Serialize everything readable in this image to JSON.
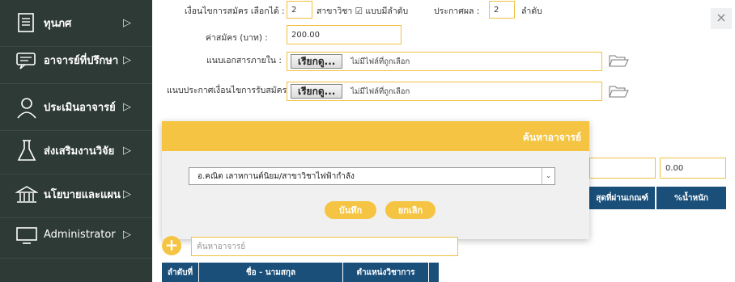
{
  "sidebar": {
    "items": [
      {
        "label": "ทุนภศ",
        "icon": "document-icon"
      },
      {
        "label": "อาจารย์ที่ปรึกษา",
        "icon": "chat-icon"
      },
      {
        "label": "ประเมินอาจารย์",
        "icon": "teacher-icon"
      },
      {
        "label": "ส่งเสริมงานวิจัย",
        "icon": "flask-icon"
      },
      {
        "label": "นโยบายและแผน",
        "icon": "building-icon"
      },
      {
        "label": "Administrator",
        "icon": "monitor-icon"
      }
    ],
    "arrow": "▷"
  },
  "form": {
    "condition_label": "เงื่อนไขการสมัคร เลือกได้ :",
    "condition_value": "2",
    "branch_label": "สาขาวิชา ☑ แบบมีลำดับ",
    "announce_label": "ประกาศผล :",
    "announce_value": "2",
    "rank_label": "ลำดับ",
    "fee_label": "ค่าสมัคร (บาท) :",
    "fee_value": "200.00",
    "internal_doc_label": "แนบเอกสารภายใน :",
    "condition_doc_label": "แนบประกาศเงื่อนไขการรับสมัคร :",
    "browse_label": "เรียกดู...",
    "no_file_label": "ไม่มีไฟล์ที่ถูกเลือก"
  },
  "close_label": "×",
  "background": {
    "score_value": "0.00",
    "col_pass": "สุดที่ผ่านเกณฑ์",
    "col_weight": "%น้ำหนัก"
  },
  "modal": {
    "title": "ค้นหาอาจารย์",
    "selected_value": "อ.คณิต เลาหกานต์นิยม/สาขาวิชาไฟฟ้ากำลัง",
    "save_label": "บันทึก",
    "cancel_label": "ยกเลิก"
  },
  "search": {
    "placeholder": "ค้นหาอาจารย์"
  },
  "table": {
    "headers": [
      "ลำดับที่",
      "ชื่อ - นามสกุล",
      "ตำแหน่งวิชาการ"
    ]
  }
}
